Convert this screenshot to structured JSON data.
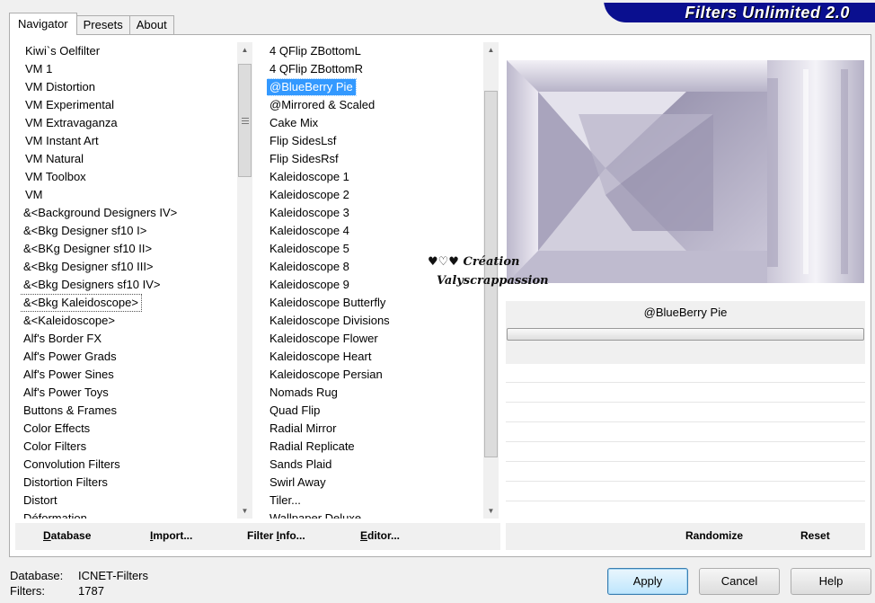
{
  "tabs": [
    {
      "label": "Navigator",
      "active": true
    },
    {
      "label": "Presets",
      "active": false
    },
    {
      "label": "About",
      "active": false
    }
  ],
  "banner": {
    "title": "Filters Unlimited 2.0",
    "color": "#0a0f8f"
  },
  "categories": [
    "Kiwi`s Oelfilter",
    "VM 1",
    "VM Distortion",
    "VM Experimental",
    "VM Extravaganza",
    "VM Instant Art",
    "VM Natural",
    "VM Toolbox",
    "VM",
    "&<Background Designers IV>",
    "&<Bkg Designer sf10 I>",
    "&<BKg Designer sf10 II>",
    "&<Bkg Designer sf10 III>",
    "&<Bkg Designers sf10 IV>",
    "&<Bkg Kaleidoscope>",
    "&<Kaleidoscope>",
    "Alf's Border FX",
    "Alf's Power Grads",
    "Alf's Power Sines",
    "Alf's Power Toys",
    "Buttons & Frames",
    "Color Effects",
    "Color Filters",
    "Convolution Filters",
    "Distortion Filters",
    "Distort",
    "Déformation"
  ],
  "focused_category": "&<Bkg Kaleidoscope>",
  "filters": [
    "4 QFlip ZBottomL",
    "4 QFlip ZBottomR",
    "@BlueBerry Pie",
    "@Mirrored & Scaled",
    "Cake Mix",
    "Flip SidesLsf",
    "Flip SidesRsf",
    "Kaleidoscope 1",
    "Kaleidoscope 2",
    "Kaleidoscope 3",
    "Kaleidoscope 4",
    "Kaleidoscope 5",
    "Kaleidoscope 8",
    "Kaleidoscope 9",
    "Kaleidoscope Butterfly",
    "Kaleidoscope Divisions",
    "Kaleidoscope Flower",
    "Kaleidoscope Heart",
    "Kaleidoscope Persian",
    "Nomads Rug",
    "Quad Flip",
    "Radial Mirror",
    "Radial Replicate",
    "Sands Plaid",
    "Swirl Away",
    "Tiler...",
    "Wallpaper Deluxe"
  ],
  "selected_filter": "@BlueBerry Pie",
  "left_bar": {
    "database": {
      "mn": "D",
      "rest": "atabase"
    },
    "import": {
      "mn": "I",
      "rest": "mport..."
    },
    "filter_info": {
      "pre": "Filter ",
      "mn": "I",
      "rest": "nfo..."
    },
    "editor": {
      "mn": "E",
      "rest": "ditor..."
    }
  },
  "right_bar": {
    "randomize": "Randomize",
    "reset": "Reset"
  },
  "preview_filter_name": "@BlueBerry Pie",
  "watermark": {
    "line1": "♥♡♥ Création",
    "line2": "Valyscrappassion"
  },
  "footer": {
    "database_label": "Database:",
    "database_value": "ICNET-Filters",
    "filters_label": "Filters:",
    "filters_value": "1787"
  },
  "buttons": {
    "apply": "Apply",
    "cancel": "Cancel",
    "help": "Help"
  },
  "icons": {
    "scroll_up": "▲",
    "scroll_down": "▼"
  }
}
